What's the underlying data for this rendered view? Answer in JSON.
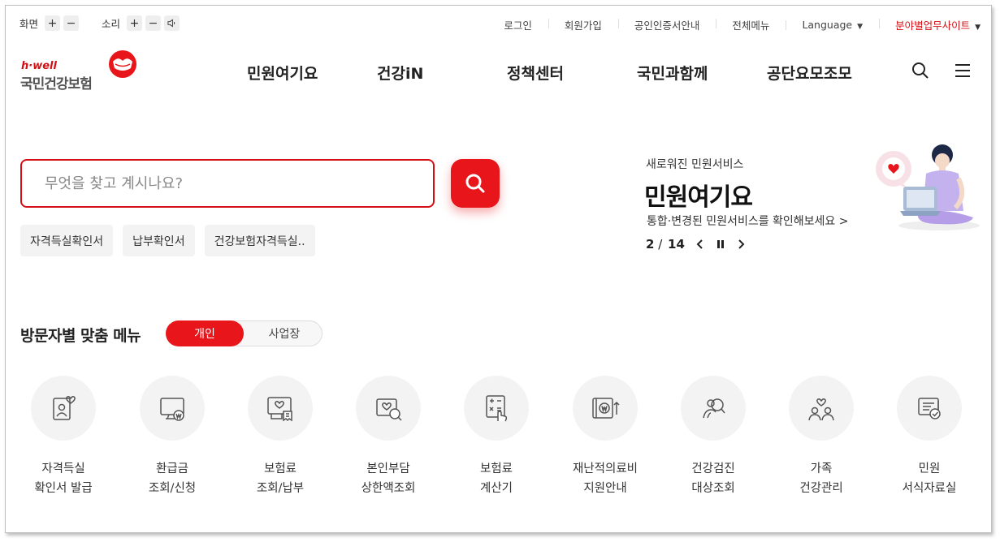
{
  "utility": {
    "screen_label": "화면",
    "sound_label": "소리",
    "plus": "+",
    "minus": "−",
    "links": [
      "로그인",
      "회원가입",
      "공인인증서안내",
      "전체메뉴"
    ],
    "language": "Language",
    "business_site": "분야별업무사이트"
  },
  "logo": {
    "tagline": "h·well",
    "name": "국민건강보험"
  },
  "gnb": [
    "민원여기요",
    "건강iN",
    "정책센터",
    "국민과함께",
    "공단요모조모"
  ],
  "search": {
    "placeholder": "무엇을 찾고 계시나요?",
    "chips": [
      "자격득실확인서",
      "납부확인서",
      "건강보험자격득실.."
    ]
  },
  "promo": {
    "subtitle": "새로워진 민원서비스",
    "title": "민원여기요",
    "link": "통합·변경된 민원서비스를 확인해보세요 >",
    "current": "2",
    "separator": " / ",
    "total": "14"
  },
  "visitor_menu": {
    "title": "방문자별 맞춤 메뉴",
    "toggle": [
      "개인",
      "사업장"
    ],
    "selected": "개인",
    "items": [
      {
        "line1": "자격득실",
        "line2": "확인서 발급",
        "icon": "id-card-heart-icon"
      },
      {
        "line1": "환급금",
        "line2": "조회/신청",
        "icon": "monitor-won-icon"
      },
      {
        "line1": "보험료",
        "line2": "조회/납부",
        "icon": "invoice-heart-icon"
      },
      {
        "line1": "본인부담",
        "line2": "상한액조회",
        "icon": "image-search-icon"
      },
      {
        "line1": "보험료",
        "line2": "계산기",
        "icon": "calculator-hand-icon"
      },
      {
        "line1": "재난적의료비",
        "line2": "지원안내",
        "icon": "wallet-won-up-icon"
      },
      {
        "line1": "건강검진",
        "line2": "대상조회",
        "icon": "person-search-icon"
      },
      {
        "line1": "가족",
        "line2": "건강관리",
        "icon": "family-heart-icon"
      },
      {
        "line1": "민원",
        "line2": "서식자료실",
        "icon": "document-check-icon"
      }
    ]
  },
  "colors": {
    "brand_red": "#e8161b",
    "text": "#222222",
    "chip_bg": "#f3f3f3"
  }
}
